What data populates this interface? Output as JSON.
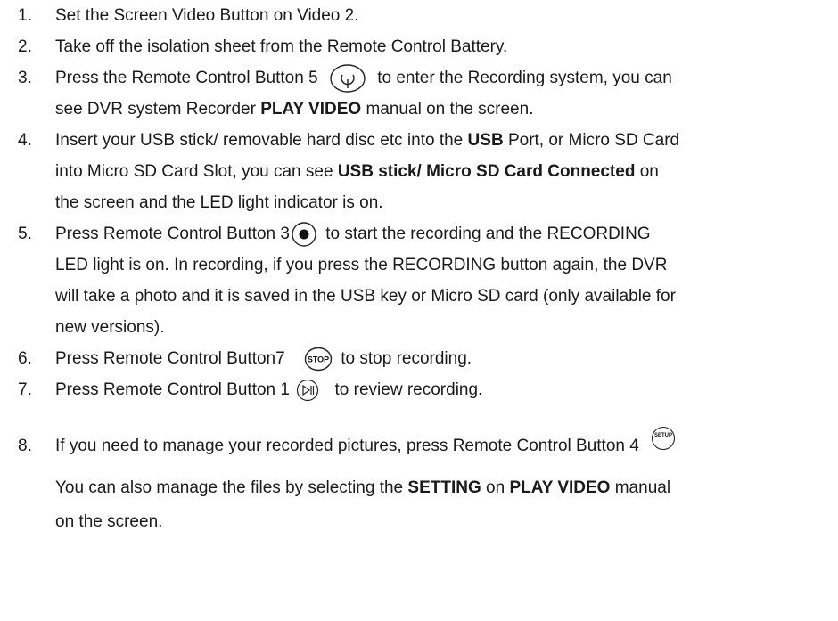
{
  "steps": [
    {
      "num": "1.",
      "text": "Set the Screen Video Button on Video 2."
    },
    {
      "num": "2.",
      "text": "Take off the isolation sheet from the Remote Control Battery."
    },
    {
      "num": "3.",
      "text_a": "Press the Remote Control Button 5",
      "icon": "power-button-icon",
      "text_b": "to enter the Recording system, you can",
      "text_c": "see DVR system Recorder",
      "bold_a": "PLAY VIDEO",
      "text_d": "manual on the screen."
    },
    {
      "num": "4.",
      "text_a": "Insert your USB stick/ removable hard disc etc into the",
      "bold_a": "USB",
      "text_b": "Port, or Micro SD Card",
      "text_c": "into Micro SD Card Slot, you can see",
      "bold_b": "USB stick/ Micro SD Card Connected",
      "text_d": "on",
      "text_e": "the screen and the LED light indicator is on."
    },
    {
      "num": "5.",
      "text_a": "Press Remote Control Button 3",
      "icon": "record-button-icon",
      "text_b": "to start the recording and the RECORDING",
      "text_c": "LED light is on. In recording, if you press the RECORDING button again, the DVR",
      "text_d": "will take a photo and it is saved in the USB key or Micro SD card (only available for",
      "text_e": "new versions)."
    },
    {
      "num": "6.",
      "text_a": "Press Remote Control Button7",
      "icon": "stop-button-icon",
      "icon_label": "STOP",
      "text_b": "to stop recording."
    },
    {
      "num": "7.",
      "text_a": "Press Remote Control Button 1",
      "icon": "play-pause-button-icon",
      "text_b": "to review recording."
    },
    {
      "num": "8.",
      "text_a": "If you need to manage your recorded pictures, press Remote Control Button 4",
      "icon": "setup-button-icon",
      "icon_label": "SETUP",
      "text_b": "You can also manage the files by selecting the",
      "bold_a": "SETTING",
      "text_c": "on",
      "bold_b": "PLAY VIDEO",
      "text_d": "manual",
      "text_e": "on the screen."
    }
  ]
}
